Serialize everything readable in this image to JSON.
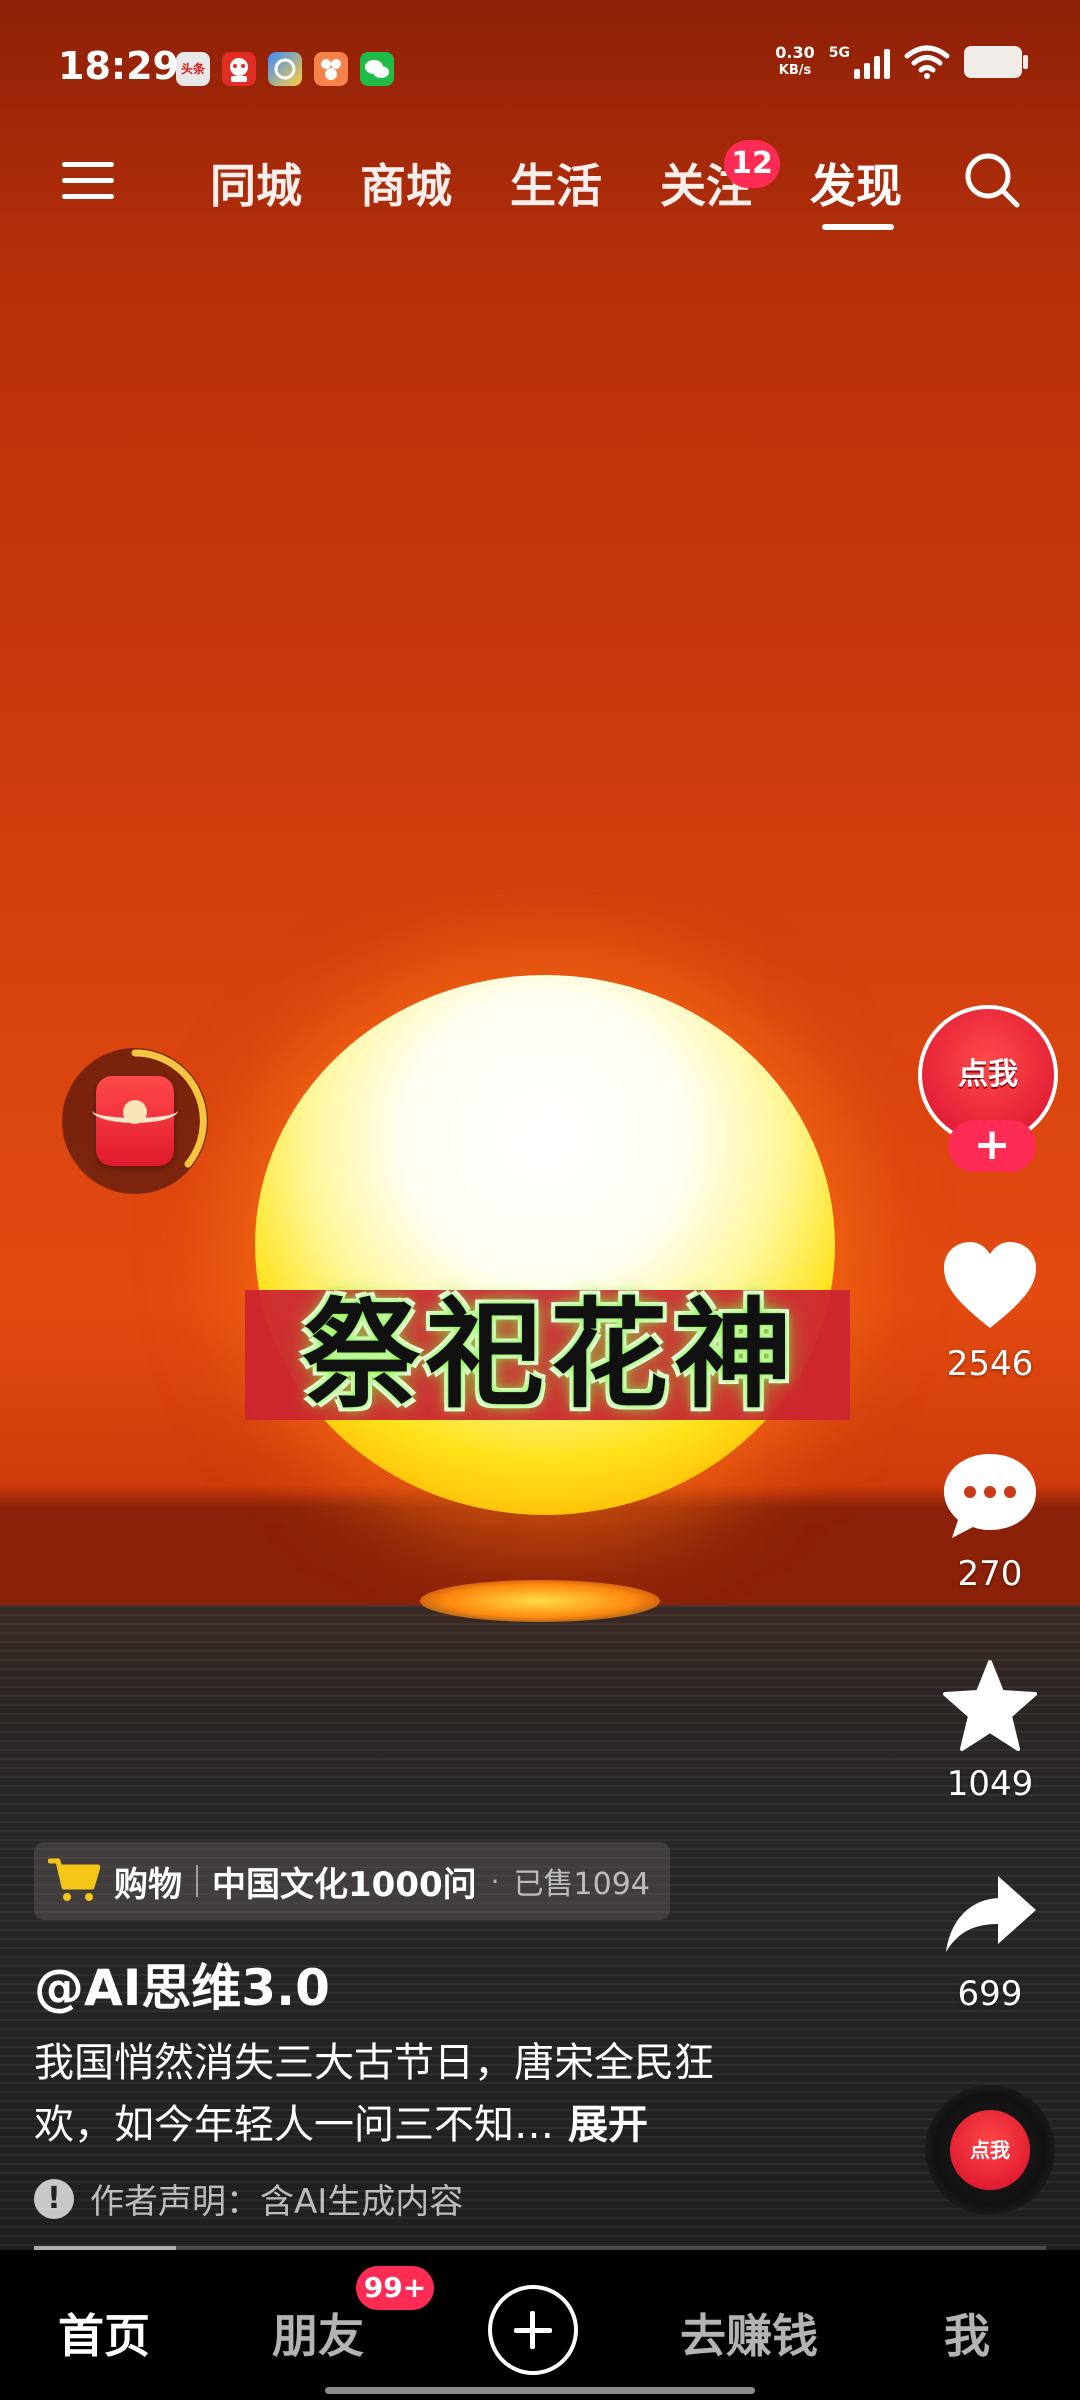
{
  "status_bar": {
    "time": "18:29",
    "net_speed_value": "0.30",
    "net_speed_unit": "KB/s",
    "network_type": "5G",
    "app_icons": [
      "toutiao-icon",
      "jd-icon",
      "browser-icon",
      "photo-icon",
      "wechat-icon"
    ],
    "app_icon_text": "头条"
  },
  "top_nav": {
    "tabs": [
      {
        "label": "同城"
      },
      {
        "label": "商城"
      },
      {
        "label": "生活"
      },
      {
        "label": "关注"
      },
      {
        "label": "发现"
      }
    ],
    "active_tab": "发现",
    "follow_badge": "12"
  },
  "video": {
    "overlay_text": "祭祀花神"
  },
  "right_rail": {
    "avatar_text": "点我",
    "follow_symbol": "+",
    "likes": "2546",
    "comments": "270",
    "favorites": "1049",
    "shares": "699",
    "disc_text": "点我"
  },
  "info": {
    "shop_label": "购物",
    "shop_title": "中国文化1000问",
    "shop_dot": "·",
    "shop_sold": "已售1094",
    "author": "@AI思维3.0",
    "description": "我国悄然消失三大古节日，唐宋全民狂欢，如今年轻人一问三不知…",
    "expand_label": "展开",
    "ai_note": "作者声明：含AI生成内容",
    "warn_symbol": "!",
    "progress": 0.14
  },
  "tab_bar": {
    "tabs": [
      {
        "label": "首页"
      },
      {
        "label": "朋友"
      },
      {
        "label": "去赚钱"
      },
      {
        "label": "我"
      }
    ],
    "friends_badge": "99+"
  },
  "colors": {
    "accent": "#fe2c55",
    "redpacket_ring": "#f5c542"
  }
}
